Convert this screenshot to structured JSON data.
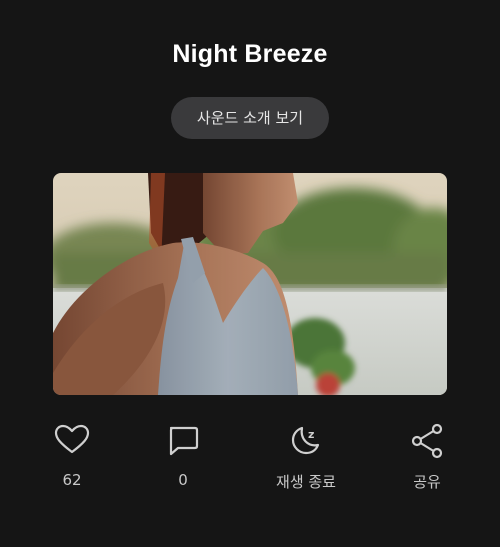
{
  "header": {
    "title": "Night Breeze"
  },
  "intro_button": {
    "label": "사운드 소개 보기"
  },
  "media": {
    "content": "photo"
  },
  "actions": {
    "like": {
      "icon": "heart-icon",
      "count": "62"
    },
    "comment": {
      "icon": "comment-icon",
      "count": "0"
    },
    "sleep_timer": {
      "icon": "moon-zz-icon",
      "label": "재생 종료"
    },
    "share": {
      "icon": "share-icon",
      "label": "공유"
    }
  },
  "colors": {
    "background": "#151515",
    "button_bg": "#3a3a3c",
    "icon": "#cfcfcf"
  }
}
